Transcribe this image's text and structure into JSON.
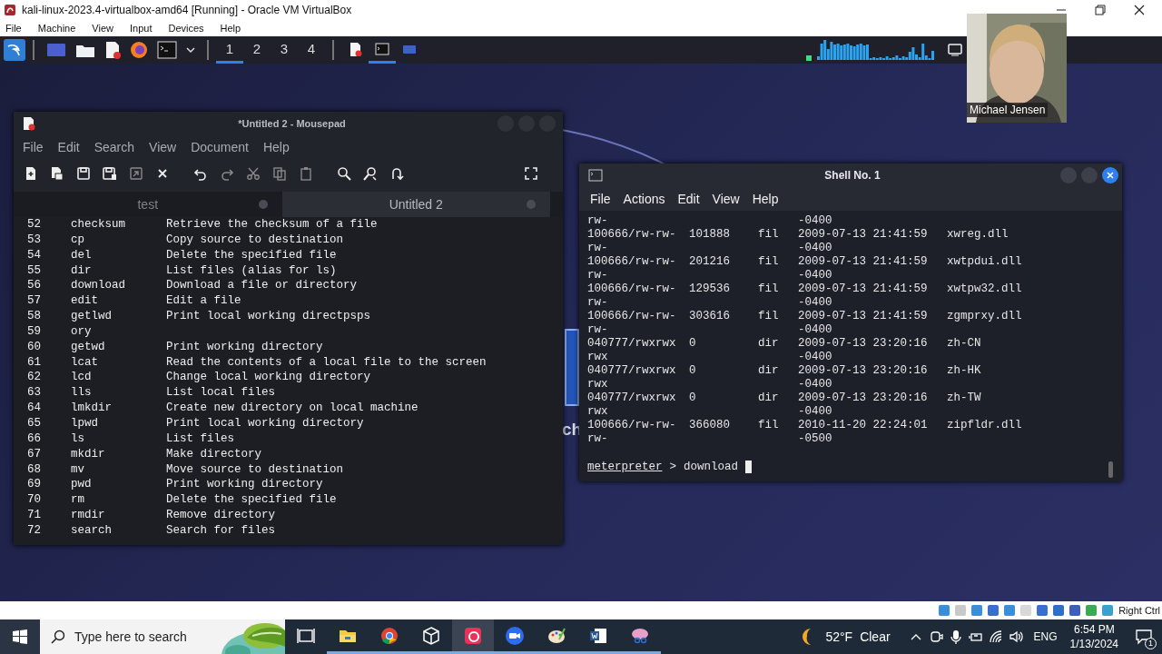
{
  "vbox": {
    "title": "kali-linux-2023.4-virtualbox-amd64 [Running] - Oracle VM VirtualBox",
    "menu": [
      "File",
      "Machine",
      "View",
      "Input",
      "Devices",
      "Help"
    ],
    "host_key": "Right Ctrl"
  },
  "panel": {
    "workspaces": [
      {
        "label": "1",
        "selected": true
      },
      {
        "label": "2",
        "selected": false
      },
      {
        "label": "3",
        "selected": false
      },
      {
        "label": "4",
        "selected": false
      }
    ],
    "tasks": [
      {
        "kind": "editor",
        "selected": false
      },
      {
        "kind": "terminal",
        "selected": true
      },
      {
        "kind": "window",
        "selected": false
      }
    ]
  },
  "desktop": {
    "label": "ch"
  },
  "mousepad": {
    "title": "*Untitled 2 - Mousepad",
    "menu": [
      "File",
      "Edit",
      "Search",
      "View",
      "Document",
      "Help"
    ],
    "tabs": [
      {
        "label": "test",
        "selected": false
      },
      {
        "label": "Untitled 2",
        "selected": true
      }
    ],
    "lines": [
      {
        "number": "52",
        "command": "checksum",
        "description": "Retrieve the checksum of a file"
      },
      {
        "number": "53",
        "command": "cp",
        "description": "Copy source to destination"
      },
      {
        "number": "54",
        "command": "del",
        "description": "Delete the specified file"
      },
      {
        "number": "55",
        "command": "dir",
        "description": "List files (alias for ls)"
      },
      {
        "number": "56",
        "command": "download",
        "description": "Download a file or directory"
      },
      {
        "number": "57",
        "command": "edit",
        "description": "Edit a file"
      },
      {
        "number": "58",
        "command": "getlwd",
        "description": "Print local working directpsps"
      },
      {
        "number": "59",
        "command": "ory"
      },
      {
        "number": "60",
        "command": "getwd",
        "description": "Print working directory"
      },
      {
        "number": "61",
        "command": "lcat",
        "description": "Read the contents of a local file to the screen"
      },
      {
        "number": "62",
        "command": "lcd",
        "description": "Change local working directory"
      },
      {
        "number": "63",
        "command": "lls",
        "description": "List local files"
      },
      {
        "number": "64",
        "command": "lmkdir",
        "description": "Create new directory on local machine"
      },
      {
        "number": "65",
        "command": "lpwd",
        "description": "Print local working directory"
      },
      {
        "number": "66",
        "command": "ls",
        "description": "List files"
      },
      {
        "number": "67",
        "command": "mkdir",
        "description": "Make directory"
      },
      {
        "number": "68",
        "command": "mv",
        "description": "Move source to destination"
      },
      {
        "number": "69",
        "command": "pwd",
        "description": "Print working directory"
      },
      {
        "number": "70",
        "command": "rm",
        "description": "Delete the specified file"
      },
      {
        "number": "71",
        "command": "rmdir",
        "description": "Remove directory"
      },
      {
        "number": "72",
        "command": "search",
        "description": "Search for files"
      }
    ]
  },
  "shell": {
    "title": "Shell No. 1",
    "menu": [
      "File",
      "Actions",
      "Edit",
      "View",
      "Help"
    ],
    "lines": [
      {
        "mode": "rw-",
        "modified": "-0400"
      },
      {
        "mode": "100666/rw-rw-",
        "size": "101888",
        "type": "fil",
        "modified": "2009-07-13 21:41:59",
        "name": "xwreg.dll"
      },
      {
        "mode": "rw-",
        "modified": "-0400"
      },
      {
        "mode": "100666/rw-rw-",
        "size": "201216",
        "type": "fil",
        "modified": "2009-07-13 21:41:59",
        "name": "xwtpdui.dll"
      },
      {
        "mode": "rw-",
        "modified": "-0400"
      },
      {
        "mode": "100666/rw-rw-",
        "size": "129536",
        "type": "fil",
        "modified": "2009-07-13 21:41:59",
        "name": "xwtpw32.dll"
      },
      {
        "mode": "rw-",
        "modified": "-0400"
      },
      {
        "mode": "100666/rw-rw-",
        "size": "303616",
        "type": "fil",
        "modified": "2009-07-13 21:41:59",
        "name": "zgmprxy.dll"
      },
      {
        "mode": "rw-",
        "modified": "-0400"
      },
      {
        "mode": "040777/rwxrwx",
        "size": "0",
        "type": "dir",
        "modified": "2009-07-13 23:20:16",
        "name": "zh-CN"
      },
      {
        "mode": "rwx",
        "modified": "-0400"
      },
      {
        "mode": "040777/rwxrwx",
        "size": "0",
        "type": "dir",
        "modified": "2009-07-13 23:20:16",
        "name": "zh-HK"
      },
      {
        "mode": "rwx",
        "modified": "-0400"
      },
      {
        "mode": "040777/rwxrwx",
        "size": "0",
        "type": "dir",
        "modified": "2009-07-13 23:20:16",
        "name": "zh-TW"
      },
      {
        "mode": "rwx",
        "modified": "-0400"
      },
      {
        "mode": "100666/rw-rw-",
        "size": "366080",
        "type": "fil",
        "modified": "2010-11-20 22:24:01",
        "name": "zipfldr.dll"
      },
      {
        "mode": "rw-",
        "modified": "-0500"
      }
    ],
    "prompt": "meterpreter",
    "prompt_symbol": ">",
    "command": "download"
  },
  "webcam": {
    "kind": "picture",
    "name": "Michael Jensen"
  },
  "taskbar": {
    "search_placeholder": "Type here to search",
    "apps": [
      {
        "kind": "taskview",
        "running": false,
        "selected": false
      },
      {
        "kind": "explorer",
        "running": true,
        "selected": false
      },
      {
        "kind": "chrome",
        "running": true,
        "selected": false
      },
      {
        "kind": "virtualbox",
        "running": true,
        "selected": false
      },
      {
        "kind": "kali",
        "running": true,
        "selected": true
      },
      {
        "kind": "zoom",
        "running": true,
        "selected": false
      },
      {
        "kind": "paint",
        "running": true,
        "selected": false
      },
      {
        "kind": "word",
        "running": true,
        "selected": false
      },
      {
        "kind": "snip",
        "running": true,
        "selected": false
      }
    ],
    "weather": {
      "temperature": "52°F",
      "condition": "Clear"
    },
    "language": "ENG",
    "time": "6:54 PM",
    "date": "1/13/2024",
    "notifications": "1"
  }
}
